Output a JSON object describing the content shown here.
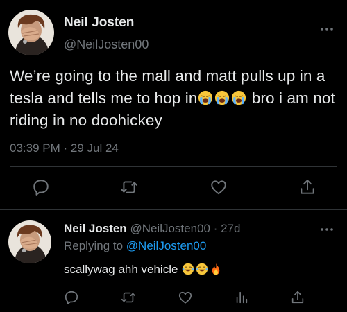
{
  "main_tweet": {
    "author_name": "Neil Josten",
    "author_handle": "@NeilJosten00",
    "text_part1": "We’re going to the mall and matt pulls up in a tesla and tells me to hop in",
    "text_part2": " bro i am not riding in no doohickey",
    "emojis": [
      "loudly-crying-face",
      "loudly-crying-face",
      "loudly-crying-face"
    ],
    "timestamp": "03:39 PM · 29 Jul 24",
    "actions": [
      "reply-icon",
      "retweet-icon",
      "like-icon",
      "share-icon"
    ]
  },
  "reply_tweet": {
    "author_name": "Neil Josten",
    "author_handle": "@NeilJosten00",
    "age": "27d",
    "meta_separator": " · ",
    "replying_prefix": "Replying to ",
    "replying_to": "@NeilJosten00",
    "text": "scallywag ahh vehicle ",
    "emojis": [
      "face-with-tears-of-joy",
      "face-with-tears-of-joy",
      "fire"
    ],
    "actions": [
      "reply-icon",
      "retweet-icon",
      "like-icon",
      "analytics-icon",
      "share-icon"
    ]
  },
  "colors": {
    "background": "#000000",
    "text": "#e7e9ea",
    "muted": "#71767b",
    "link": "#1d9bf0",
    "divider": "#2f3336"
  }
}
